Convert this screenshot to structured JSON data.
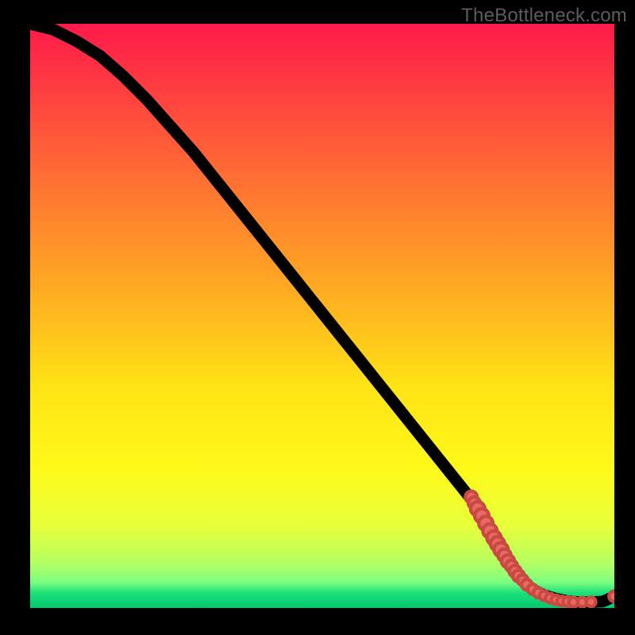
{
  "watermark": "TheBottleneck.com",
  "colors": {
    "frame": "#000000",
    "marker_fill": "#e96a63",
    "marker_stroke": "#c84a43",
    "curve": "#000000",
    "text": "#5c5c5c"
  },
  "chart_data": {
    "type": "line",
    "title": "",
    "xlabel": "",
    "ylabel": "",
    "xlim": [
      0,
      100
    ],
    "ylim": [
      0,
      100
    ],
    "grid": false,
    "legend": false,
    "series": [
      {
        "name": "bottleneck-curve",
        "x": [
          0,
          4,
          8,
          12,
          16,
          20,
          24,
          28,
          32,
          36,
          40,
          44,
          48,
          52,
          56,
          60,
          64,
          68,
          72,
          76,
          79,
          82,
          84,
          86,
          88,
          90,
          92,
          94,
          96,
          98,
          100
        ],
        "values": [
          100,
          99,
          97,
          94.5,
          91,
          87,
          82.5,
          78,
          73,
          68,
          63,
          58,
          53,
          48,
          43,
          38,
          33,
          28,
          23,
          18,
          12,
          7.5,
          5,
          3.2,
          2.2,
          1.6,
          1.2,
          1.0,
          1.0,
          1.1,
          2.0
        ]
      }
    ],
    "markers": [
      {
        "x": 75.5,
        "y": 19.0,
        "r": 1.0
      },
      {
        "x": 76.0,
        "y": 18.0,
        "r": 1.0
      },
      {
        "x": 76.6,
        "y": 17.0,
        "r": 1.2
      },
      {
        "x": 77.3,
        "y": 15.8,
        "r": 1.2
      },
      {
        "x": 78.0,
        "y": 14.5,
        "r": 1.2
      },
      {
        "x": 78.7,
        "y": 13.2,
        "r": 1.2
      },
      {
        "x": 79.4,
        "y": 12.0,
        "r": 1.2
      },
      {
        "x": 80.0,
        "y": 11.0,
        "r": 1.2
      },
      {
        "x": 80.6,
        "y": 10.0,
        "r": 1.2
      },
      {
        "x": 81.2,
        "y": 9.0,
        "r": 1.1
      },
      {
        "x": 81.8,
        "y": 8.0,
        "r": 1.1
      },
      {
        "x": 82.4,
        "y": 7.2,
        "r": 1.0
      },
      {
        "x": 83.0,
        "y": 6.3,
        "r": 1.0
      },
      {
        "x": 83.6,
        "y": 5.5,
        "r": 1.0
      },
      {
        "x": 84.3,
        "y": 4.8,
        "r": 0.9
      },
      {
        "x": 85.0,
        "y": 4.0,
        "r": 0.9
      },
      {
        "x": 86.0,
        "y": 3.2,
        "r": 0.85
      },
      {
        "x": 87.0,
        "y": 2.6,
        "r": 0.85
      },
      {
        "x": 88.0,
        "y": 2.1,
        "r": 0.8
      },
      {
        "x": 89.0,
        "y": 1.7,
        "r": 0.8
      },
      {
        "x": 90.0,
        "y": 1.4,
        "r": 0.8
      },
      {
        "x": 91.0,
        "y": 1.2,
        "r": 0.8
      },
      {
        "x": 92.0,
        "y": 1.1,
        "r": 0.8
      },
      {
        "x": 93.0,
        "y": 1.0,
        "r": 0.8
      },
      {
        "x": 94.5,
        "y": 1.0,
        "r": 0.8
      },
      {
        "x": 96.0,
        "y": 1.05,
        "r": 0.8
      },
      {
        "x": 100.0,
        "y": 2.0,
        "r": 0.9
      }
    ]
  }
}
